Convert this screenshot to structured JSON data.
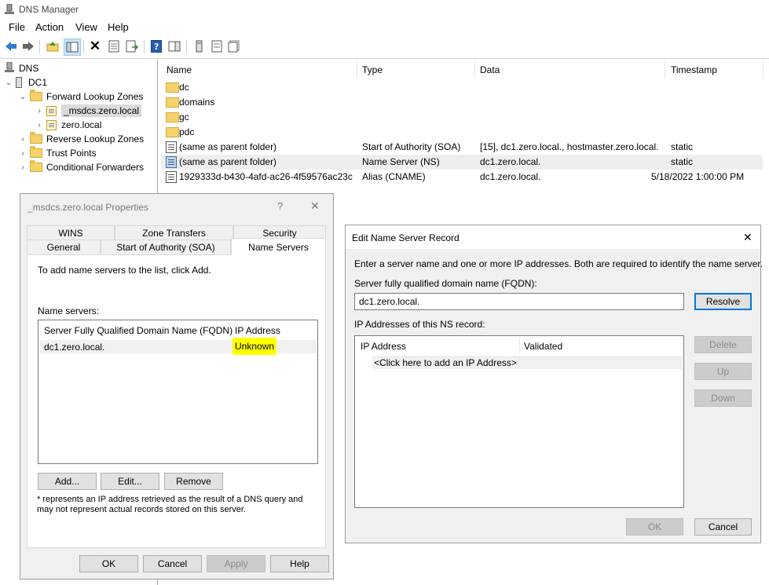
{
  "app": {
    "title": "DNS Manager",
    "icon": "dns-manager-icon"
  },
  "menu": [
    "File",
    "Action",
    "View",
    "Help"
  ],
  "toolbar": {
    "buttons": [
      "back-arrow-icon",
      "forward-arrow-icon",
      "up-folder-icon",
      "show-hide-tree-icon",
      "delete-icon",
      "properties-icon",
      "export-icon",
      "help-icon",
      "action-pane-icon",
      "server-icon",
      "zone-icon",
      "records-icon"
    ]
  },
  "tree": {
    "root": "DNS",
    "server": "DC1",
    "forward": "Forward Lookup Zones",
    "zone1": "_msdcs.zero.local",
    "zone2": "zero.local",
    "reverse": "Reverse Lookup Zones",
    "trust": "Trust Points",
    "conditional": "Conditional Forwarders"
  },
  "list": {
    "columns": [
      "Name",
      "Type",
      "Data",
      "Timestamp"
    ],
    "rows": [
      {
        "name": "dc",
        "type": "",
        "data": "",
        "timestamp": ""
      },
      {
        "name": "domains",
        "type": "",
        "data": "",
        "timestamp": ""
      },
      {
        "name": "gc",
        "type": "",
        "data": "",
        "timestamp": ""
      },
      {
        "name": "pdc",
        "type": "",
        "data": "",
        "timestamp": ""
      },
      {
        "name": "(same as parent folder)",
        "type": "Start of Authority (SOA)",
        "data": "[15], dc1.zero.local., hostmaster.zero.local.",
        "timestamp": "static"
      },
      {
        "name": "(same as parent folder)",
        "type": "Name Server (NS)",
        "data": "dc1.zero.local.",
        "timestamp": "static"
      },
      {
        "name": "1929333d-b430-4afd-ac26-4f59576ac23c",
        "type": "Alias (CNAME)",
        "data": "dc1.zero.local.",
        "timestamp": "5/18/2022 1:00:00 PM"
      }
    ]
  },
  "props": {
    "title": "_msdcs.zero.local Properties",
    "help_glyph": "?",
    "close_glyph": "✕",
    "tabs_top": [
      "WINS",
      "Zone Transfers",
      "Security"
    ],
    "tabs_bottom": [
      "General",
      "Start of Authority (SOA)",
      "Name Servers"
    ],
    "intro": "To add name servers to the list, click Add.",
    "ns_label": "Name servers:",
    "col_fqdn": "Server Fully Qualified Domain Name (FQDN)",
    "col_ip": "IP Address",
    "row_fqdn": "dc1.zero.local.",
    "row_ip": "Unknown",
    "add": "Add...",
    "edit": "Edit...",
    "remove": "Remove",
    "note": "* represents an IP address retrieved as the result of a DNS query and may not represent actual records stored on this server.",
    "ok": "OK",
    "cancel": "Cancel",
    "apply": "Apply",
    "help": "Help"
  },
  "nsedit": {
    "title": "Edit Name Server Record",
    "close_glyph": "✕",
    "intro": "Enter a server name and one or more IP addresses.  Both are required to identify the name server.",
    "fqdn_label": "Server fully qualified domain name (FQDN):",
    "fqdn_value": "dc1.zero.local.",
    "resolve": "Resolve",
    "ip_label": "IP Addresses of this NS record:",
    "col_ip": "IP Address",
    "col_validated": "Validated",
    "add_row": "<Click here to add an IP Address>",
    "delete": "Delete",
    "up": "Up",
    "down": "Down",
    "ok": "OK",
    "cancel": "Cancel"
  }
}
